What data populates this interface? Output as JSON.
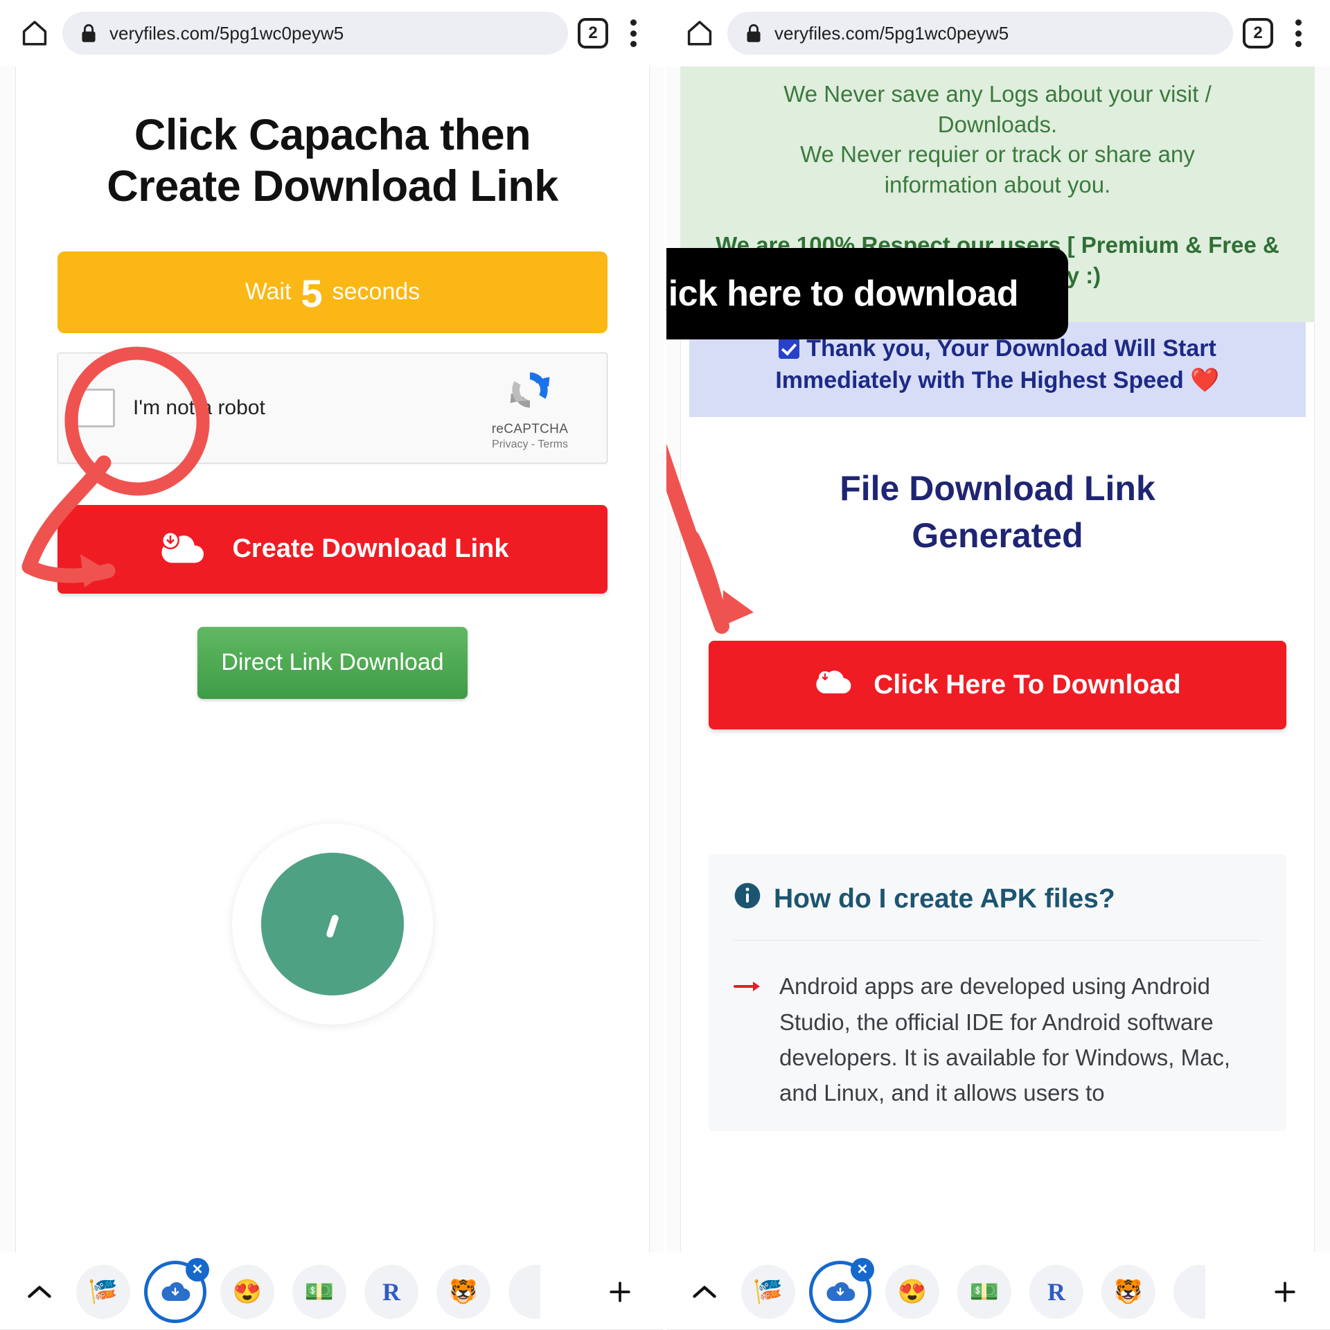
{
  "browser": {
    "url": "veryfiles.com/5pg1wc0peyw5",
    "tab_count": "2",
    "home_icon": "home-icon",
    "lock_icon": "lock-icon",
    "menu_icon": "kebab-menu-icon"
  },
  "left_page": {
    "heading_line1": "Click Capacha then",
    "heading_line2": "Create Download Link",
    "wait_button": {
      "prefix": "Wait",
      "seconds": "5",
      "suffix": "seconds",
      "color": "#fbb716"
    },
    "recaptcha": {
      "checkbox_label": "I'm not a robot",
      "brand": "reCAPTCHA",
      "legal": "Privacy - Terms",
      "logo_icon": "recaptcha-logo-icon"
    },
    "create_button": {
      "label": "Create Download Link",
      "icon": "cloud-download-icon",
      "color": "#f01c24"
    },
    "direct_button": {
      "label": "Direct Link Download",
      "color": "#4ba751"
    },
    "spinner": {
      "icon": "loading-spinner-icon",
      "color": "#4fa183"
    },
    "annotation_circle": "red-marker-circle",
    "annotation_arrow": "red-marker-arrow"
  },
  "right_page": {
    "privacy_notice": {
      "line1": "We Never save any Logs about your visit /",
      "line2": "Downloads.",
      "line3": "We Never requier or track or share any",
      "line4": "information about you.",
      "bold_line": "We are 100% Respect our users [ Premium & Free & Visitors ] Privacy :)",
      "bg_color": "#dfeedd",
      "text_color": "#3c7a3f"
    },
    "overlay_banner": {
      "label": "Click here to download",
      "bg_color": "#000000",
      "text_color": "#ffffff"
    },
    "thanks_box": {
      "line1": "Thank you, Your Download Will Start",
      "line2": "Immediately with The Highest Speed",
      "heart": "❤️",
      "checkbox_icon": "checked-box-icon",
      "bg_color": "#d7ddf7",
      "text_color": "#1d2a86"
    },
    "generated_title_line1": "File Download Link",
    "generated_title_line2": "Generated",
    "download_button": {
      "label": "Click Here To Download",
      "icon": "cloud-download-icon",
      "color": "#f01c24"
    },
    "faq": {
      "info_icon": "info-circle-icon",
      "question": "How do I create APK files?",
      "bullet_icon": "red-arrow-icon",
      "answer": "Android apps are developed using Android Studio, the official IDE for Android software developers. It is available for Windows, Mac, and Linux, and it allows users to"
    },
    "annotation_arrow": "red-marker-arrow"
  },
  "keyboard_bar": {
    "caret_icon": "chevron-up-icon",
    "add_icon": "plus-icon",
    "items": [
      {
        "name": "sticker-app-icon",
        "glyph": "🎏"
      },
      {
        "name": "cloud-download-app-icon",
        "glyph": "☁",
        "selected": true,
        "badge": "✕"
      },
      {
        "name": "heart-eyes-emoji-icon",
        "glyph": "😍"
      },
      {
        "name": "money-transfer-app-icon",
        "glyph": "💵"
      },
      {
        "name": "letter-r-app-icon",
        "glyph": "R"
      },
      {
        "name": "tiger-emoji-icon",
        "glyph": "🐯"
      },
      {
        "name": "partial-app-icon",
        "glyph": ""
      }
    ]
  }
}
